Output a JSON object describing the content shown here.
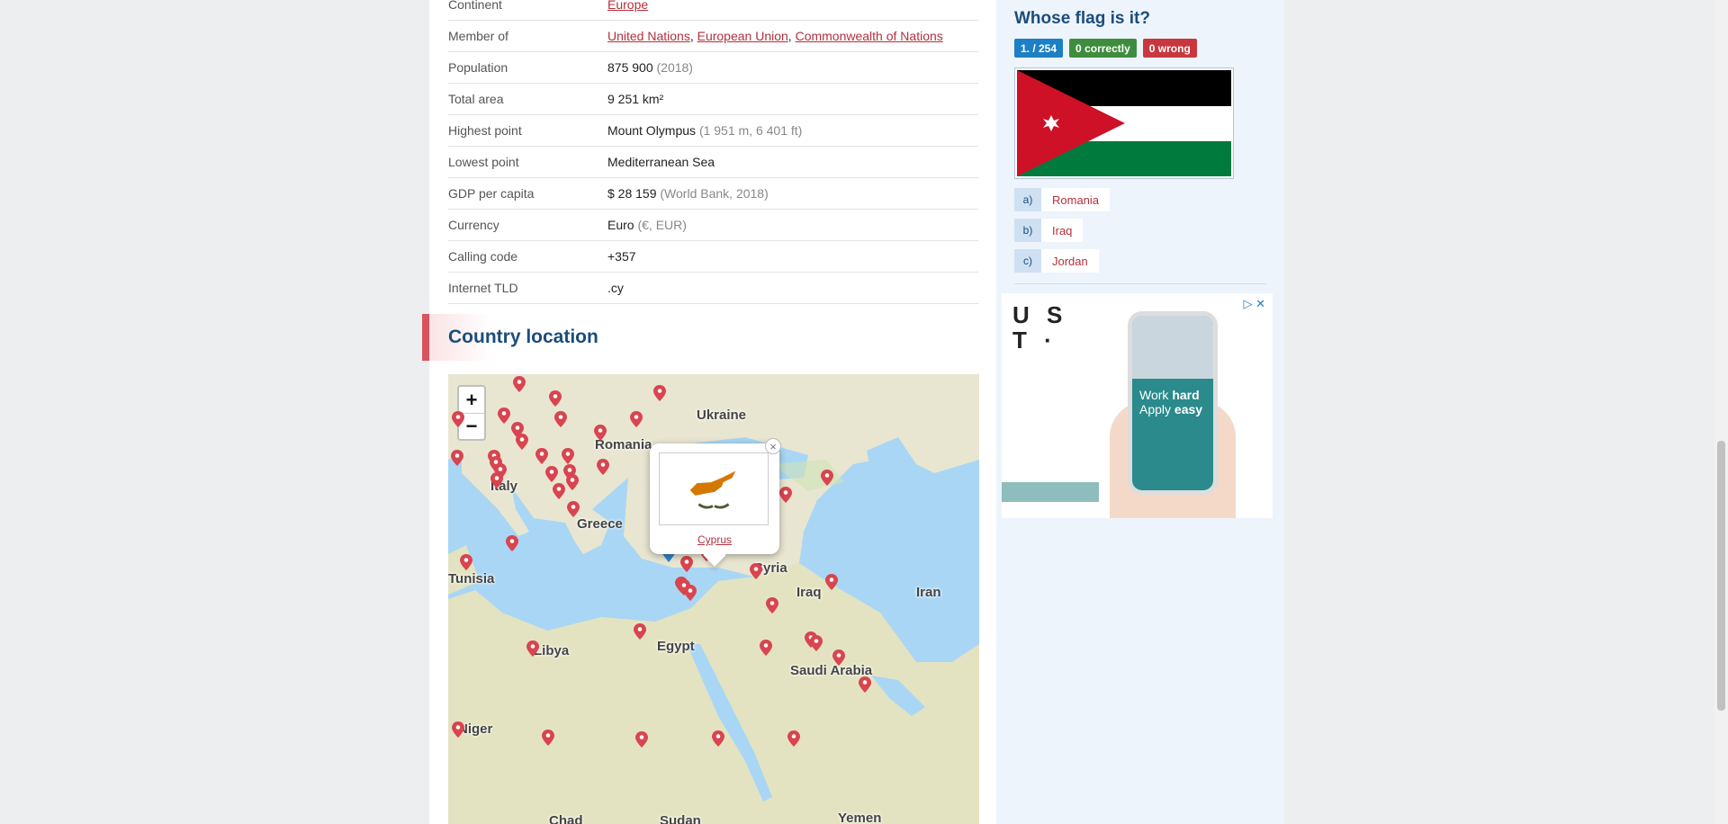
{
  "facts": [
    {
      "label": "Continent",
      "value": "",
      "links": [
        "Europe"
      ],
      "extra": ""
    },
    {
      "label": "Member of",
      "value": "",
      "links": [
        "United Nations",
        "European Union",
        "Commonwealth of Nations"
      ],
      "extra": ""
    },
    {
      "label": "Population",
      "value": "875 900",
      "links": [],
      "extra": "(2018)"
    },
    {
      "label": "Total area",
      "value": "9 251 km²",
      "links": [],
      "extra": ""
    },
    {
      "label": "Highest point",
      "value": "Mount Olympus",
      "links": [],
      "extra": "(1 951 m, 6 401 ft)"
    },
    {
      "label": "Lowest point",
      "value": "Mediterranean Sea",
      "links": [],
      "extra": ""
    },
    {
      "label": "GDP per capita",
      "value": "$ 28 159",
      "links": [],
      "extra": "(World Bank, 2018)"
    },
    {
      "label": "Currency",
      "value": "Euro",
      "links": [],
      "extra": "(€, EUR)"
    },
    {
      "label": "Calling code",
      "value": "+357",
      "links": [],
      "extra": ""
    },
    {
      "label": "Internet TLD",
      "value": ".cy",
      "links": [],
      "extra": ""
    }
  ],
  "section": {
    "title": "Country location"
  },
  "map": {
    "zoom_in": "+",
    "zoom_out": "−",
    "popup_link": "Cyprus",
    "popup_close": "×",
    "labels": [
      "Ukraine",
      "Romania",
      "Italy",
      "Greece",
      "Tunisia",
      "Syria",
      "Iraq",
      "Iran",
      "Libya",
      "Egypt",
      "Saudi Arabia",
      "Niger",
      "Chad",
      "Sudan",
      "Yemen"
    ]
  },
  "quiz": {
    "title": "Whose flag is it?",
    "progress": "1. / 254",
    "correct_count": "0",
    "correct_label": "correctly",
    "wrong_count": "0",
    "wrong_label": "wrong",
    "answers": [
      {
        "letter": "a)",
        "text": "Romania"
      },
      {
        "letter": "b)",
        "text": "Iraq"
      },
      {
        "letter": "c)",
        "text": "Jordan"
      }
    ]
  },
  "ad": {
    "logo_line1": "U S",
    "logo_line2": "T ·",
    "text_regular1": "Work ",
    "text_bold1": "hard",
    "text_regular2": "Apply ",
    "text_bold2": "easy",
    "choices_icon": "▷",
    "close_icon": "✕"
  },
  "colors": {
    "accent": "#b3303d",
    "title": "#1b4d7a",
    "sidebar_bg": "#edf4fc"
  }
}
